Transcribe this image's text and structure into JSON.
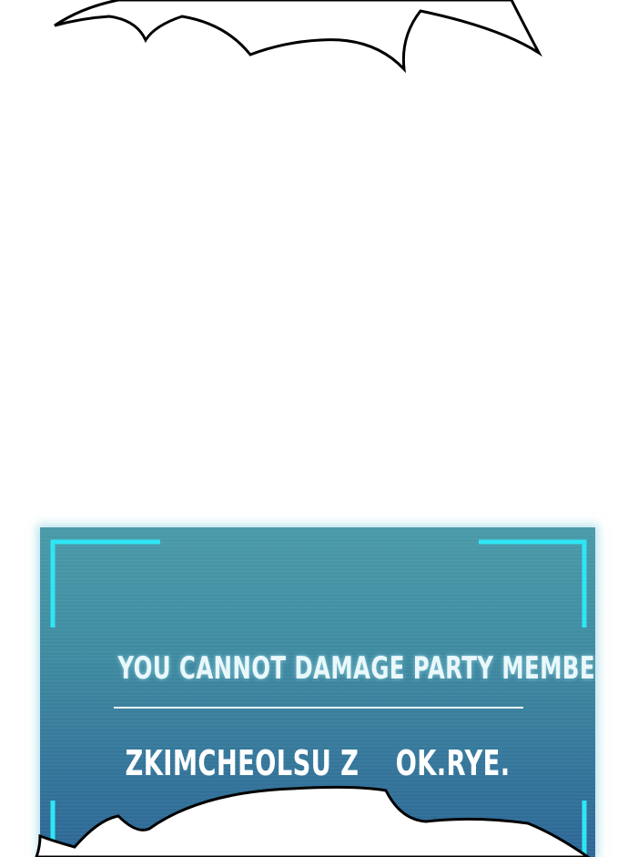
{
  "panel": {
    "message": "YOU CANNOT DAMAGE PARTY MEMBERS.",
    "name_part_1": "ZKIMCHEOLSU Z",
    "name_part_2": "OK.RYE.",
    "frame_color": "#2ee6f5",
    "background_color": "#3f8aa0"
  }
}
